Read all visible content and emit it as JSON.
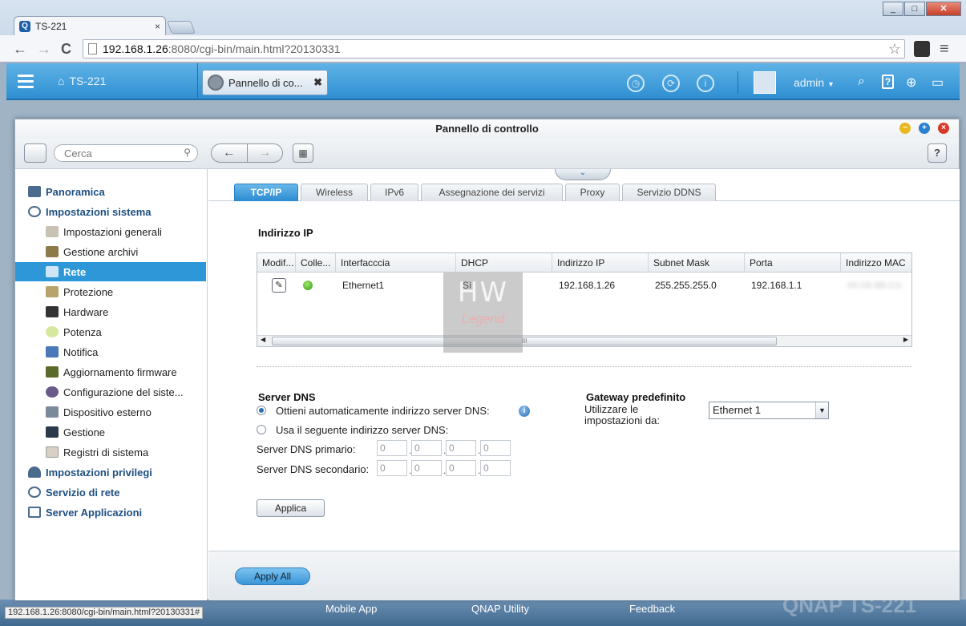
{
  "browser": {
    "tab_title": "TS-221",
    "tab_close": "×",
    "url_host": "192.168.1.26",
    "url_rest": ":8080/cgi-bin/main.html?20130331",
    "status_url": "192.168.1.26:8080/cgi-bin/main.html?20130331#",
    "back": "←",
    "forward": "→",
    "reload": "C",
    "menu": "≡",
    "star": "☆"
  },
  "qbar": {
    "home_label": "TS-221",
    "task_label": "Pannello di co...",
    "task_close": "✖",
    "user": "admin",
    "user_arrow": "▼"
  },
  "window": {
    "title": "Pannello di controllo",
    "search_placeholder": "Cerca",
    "help": "?",
    "nav_back": "←",
    "nav_forward": "→"
  },
  "sidebar": {
    "items": [
      {
        "label": "Panoramica",
        "level": "top",
        "icon": "overview-icon"
      },
      {
        "label": "Impostazioni sistema",
        "level": "top",
        "icon": "gear-icon"
      },
      {
        "label": "Impostazioni generali",
        "level": "sub",
        "icon": "settings-icon"
      },
      {
        "label": "Gestione archivi",
        "level": "sub",
        "icon": "storage-icon"
      },
      {
        "label": "Rete",
        "level": "sub",
        "icon": "network-icon",
        "active": true
      },
      {
        "label": "Protezione",
        "level": "sub",
        "icon": "lock-icon"
      },
      {
        "label": "Hardware",
        "level": "sub",
        "icon": "hardware-icon"
      },
      {
        "label": "Potenza",
        "level": "sub",
        "icon": "bulb-icon"
      },
      {
        "label": "Notifica",
        "level": "sub",
        "icon": "notification-icon"
      },
      {
        "label": "Aggiornamento firmware",
        "level": "sub",
        "icon": "firmware-icon"
      },
      {
        "label": "Configurazione del siste...",
        "level": "sub",
        "icon": "backup-icon"
      },
      {
        "label": "Dispositivo esterno",
        "level": "sub",
        "icon": "external-device-icon"
      },
      {
        "label": "Gestione",
        "level": "sub",
        "icon": "monitor-icon"
      },
      {
        "label": "Registri di sistema",
        "level": "sub",
        "icon": "log-icon"
      },
      {
        "label": "Impostazioni privilegi",
        "level": "top",
        "icon": "user-icon"
      },
      {
        "label": "Servizio di rete",
        "level": "top",
        "icon": "globe-icon"
      },
      {
        "label": "Server Applicazioni",
        "level": "top",
        "icon": "server-icon"
      }
    ]
  },
  "tabs": [
    "TCP/IP",
    "Wireless",
    "IPv6",
    "Assegnazione dei servizi",
    "Proxy",
    "Servizio DDNS"
  ],
  "ip_section": {
    "title": "Indirizzo IP",
    "columns": [
      "Modif...",
      "Colle...",
      "Interfacccia",
      "DHCP",
      "Indirizzo IP",
      "Subnet Mask",
      "Porta",
      "Indirizzo MAC"
    ],
    "row": {
      "interface": "Ethernet1",
      "dhcp": "Sì",
      "ip": "192.168.1.26",
      "mask": "255.255.255.0",
      "gateway": "192.168.1.1",
      "mac": "00:08:9B:D3:"
    },
    "scroll_grip": "III"
  },
  "dns": {
    "title": "Server DNS",
    "auto_label": "Ottieni automaticamente indirizzo server DNS:",
    "manual_label": "Usa il seguente indirizzo server DNS:",
    "primary_label": "Server DNS primario:",
    "secondary_label": "Server DNS secondario:",
    "primary": [
      "0",
      "0",
      "0",
      "0"
    ],
    "secondary": [
      "0",
      "0",
      "0",
      "0"
    ],
    "apply": "Applica"
  },
  "gateway": {
    "title": "Gateway predefinito",
    "use_label": "Utilizzare le impostazioni da:",
    "selected": "Ethernet 1"
  },
  "footer": {
    "apply_all": "Apply All"
  },
  "desktop": {
    "items": [
      "Mobile App",
      "QNAP Utility",
      "Feedback"
    ],
    "brand": "QNAP TS-221"
  },
  "watermark": {
    "top": "HW",
    "bottom": "Legend"
  },
  "colors": {
    "accent": "#2d97d8",
    "nav_text": "#1d4f82",
    "connected": "#2f9a14"
  }
}
